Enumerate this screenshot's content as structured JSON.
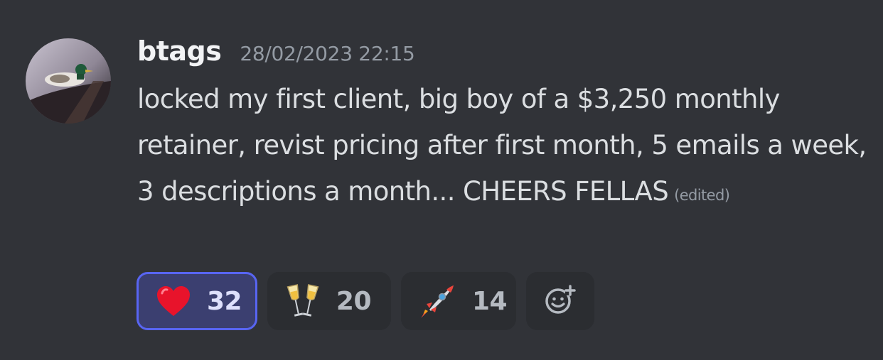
{
  "message": {
    "author": "btags",
    "timestamp": "28/02/2023 22:15",
    "content": "locked my first client, big boy of a $3,250 monthly retainer, revist pricing after first month, 5 emails a week, 3 descriptions a month... CHEERS FELLAS",
    "edited_label": "(edited)"
  },
  "reactions": [
    {
      "emoji": "red-heart-icon",
      "count": "32",
      "reacted_by_me": true
    },
    {
      "emoji": "clinking-glasses-icon",
      "count": "20",
      "reacted_by_me": false
    },
    {
      "emoji": "rocket-icon",
      "count": "14",
      "reacted_by_me": false
    }
  ],
  "colors": {
    "background": "#313338",
    "active_reaction_border": "#5865f2",
    "active_reaction_bg": "#3b3f70"
  }
}
